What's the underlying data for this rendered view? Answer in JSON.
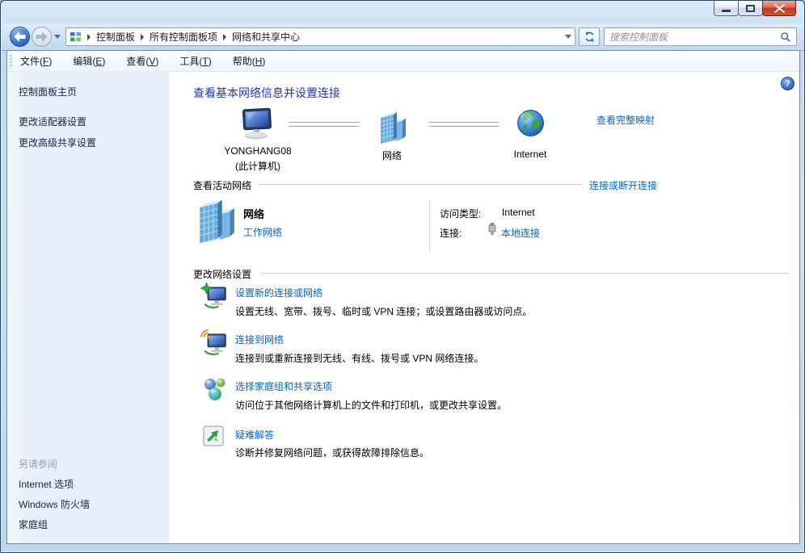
{
  "navbar": {
    "breadcrumb": [
      "控制面板",
      "所有控制面板项",
      "网络和共享中心"
    ],
    "search_placeholder": "搜索控制面板"
  },
  "menubar": {
    "items": [
      {
        "pre": "文件(",
        "key": "F",
        "post": ")"
      },
      {
        "pre": "编辑(",
        "key": "E",
        "post": ")"
      },
      {
        "pre": "查看(",
        "key": "V",
        "post": ")"
      },
      {
        "pre": "工具(",
        "key": "T",
        "post": ")"
      },
      {
        "pre": "帮助(",
        "key": "H",
        "post": ")"
      }
    ]
  },
  "sidebar": {
    "home": "控制面板主页",
    "tasks": [
      "更改适配器设置",
      "更改高级共享设置"
    ],
    "see_also": {
      "header": "另请参阅",
      "items": [
        "Internet 选项",
        "Windows 防火墙",
        "家庭组"
      ]
    }
  },
  "main": {
    "heading": "查看基本网络信息并设置连接",
    "help_glyph": "?",
    "map": {
      "computer_name": "YONGHANG08",
      "computer_sub": "(此计算机)",
      "network_label": "网络",
      "internet_label": "Internet",
      "full_map_link": "查看完整映射"
    },
    "active_networks": {
      "header": "查看活动网络",
      "action_link": "连接或断开连接",
      "network_name": "网络",
      "network_category": "工作网络",
      "access_type_label": "访问类型:",
      "access_type_value": "Internet",
      "connections_label": "连接:",
      "connections_value": "本地连接"
    },
    "network_settings": {
      "header": "更改网络设置",
      "items": [
        {
          "title": "设置新的连接或网络",
          "desc": "设置无线、宽带、拨号、临时或 VPN 连接；或设置路由器或访问点。"
        },
        {
          "title": "连接到网络",
          "desc": "连接到或重新连接到无线、有线、拨号或 VPN 网络连接。"
        },
        {
          "title": "选择家庭组和共享选项",
          "desc": "访问位于其他网络计算机上的文件和打印机，或更改共享设置。"
        },
        {
          "title": "疑难解答",
          "desc": "诊断并修复网络问题，或获得故障排除信息。"
        }
      ]
    }
  },
  "icons": {
    "back": "arrow-left-circle",
    "forward": "arrow-right-circle",
    "refresh": "refresh-arrows",
    "search": "magnifier",
    "address_app": "control-panel-grid",
    "help": "question-mark-circle",
    "minimize": "minimize-bar",
    "maximize": "maximize-box",
    "close": "close-x",
    "map_computer": "desktop-computer",
    "map_network": "office-buildings",
    "map_internet": "globe",
    "connection": "ethernet-plug",
    "item_new_connection": "monitor-new-star",
    "item_connect": "monitor-wireless",
    "item_homegroup": "homegroup-spheres",
    "item_troubleshoot": "diagnostic-arrows"
  },
  "colors": {
    "link": "#0066cc",
    "heading": "#2038b4",
    "sidebar_link": "#15234f",
    "muted": "#9aa2ac",
    "frame": "#c3d9ee"
  }
}
